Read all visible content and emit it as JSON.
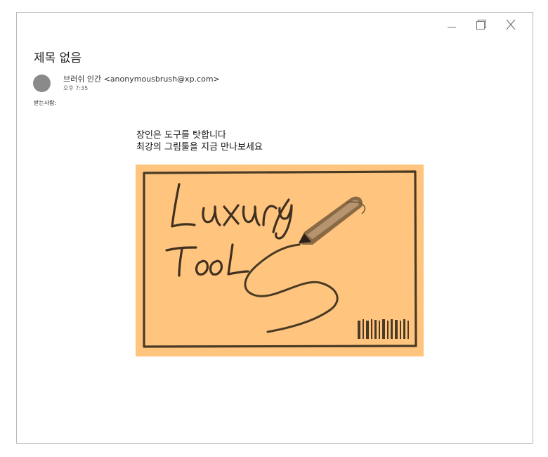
{
  "window": {
    "controls": [
      {
        "name": "minimize",
        "icon": "minimize-icon"
      },
      {
        "name": "maximize",
        "icon": "maximize-icon"
      },
      {
        "name": "close",
        "icon": "close-icon"
      }
    ]
  },
  "email": {
    "subject": "제목 없음",
    "sender": "브러쉬 인간 <anonymousbrush@xp.com>",
    "time": "오후 7:35",
    "to_label": "받는사람:",
    "body_lines": [
      "장인은 도구를 탓합니다",
      "최강의 그림툴을 지금 만나보세요"
    ]
  },
  "image": {
    "logo_text": [
      "Luxury",
      "Tool"
    ],
    "background_color": "#ffc57f",
    "stroke_color": "#4a3a24"
  },
  "colors": {
    "avatar": "#8a8a8a",
    "window_border": "#b9b9b9"
  }
}
